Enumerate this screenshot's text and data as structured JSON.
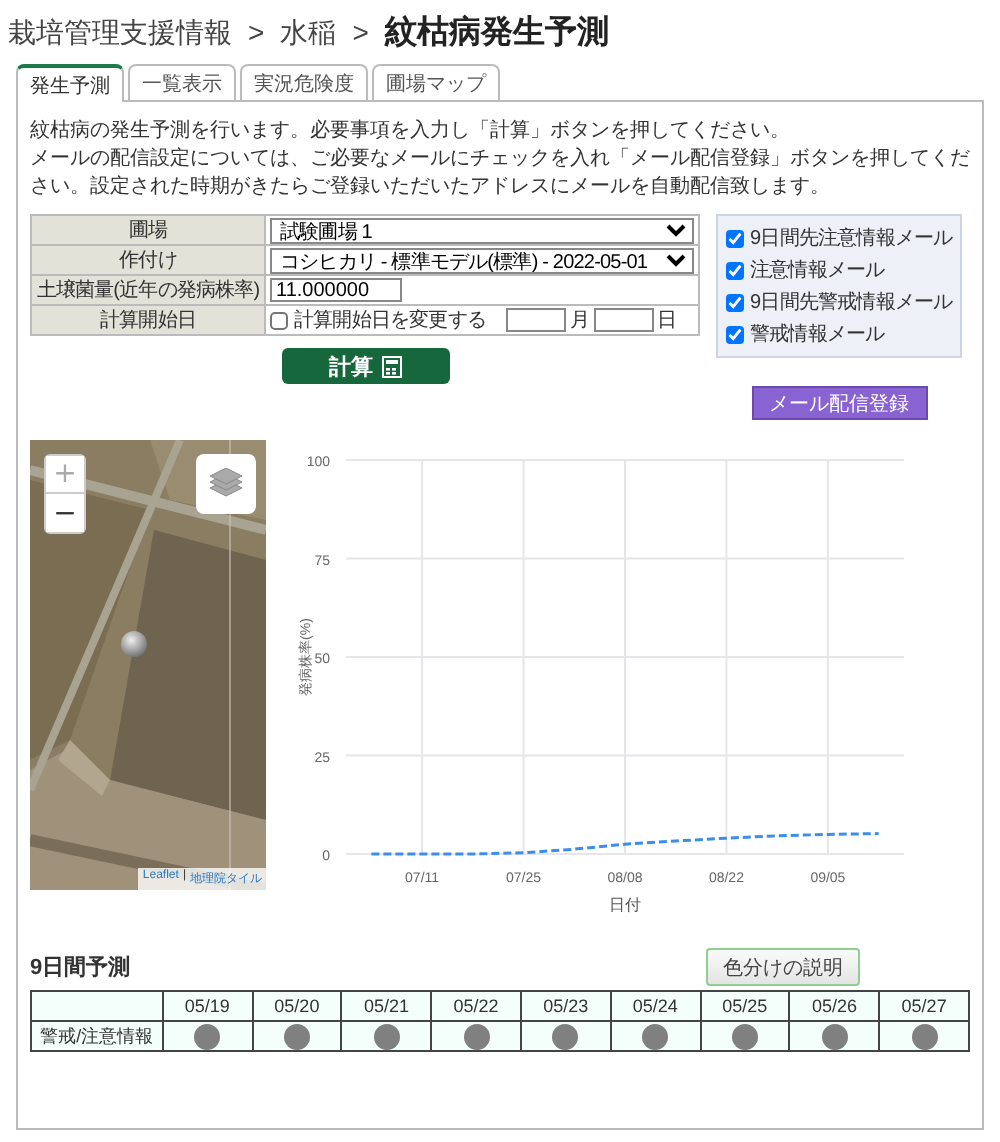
{
  "breadcrumb": [
    {
      "text": "栽培管理支援情報",
      "current": false
    },
    {
      "text": "水稲",
      "current": false
    },
    {
      "text": "紋枯病発生予測",
      "current": true
    }
  ],
  "breadcrumb_separator": ">",
  "tabs": [
    {
      "label": "発生予測",
      "selected": true
    },
    {
      "label": "一覧表示",
      "selected": false
    },
    {
      "label": "実況危険度",
      "selected": false
    },
    {
      "label": "圃場マップ",
      "selected": false
    }
  ],
  "description": [
    "紋枯病の発生予測を行います。必要事項を入力し「計算」ボタンを押してください。",
    "メールの配信設定については、ご必要なメールにチェックを入れ「メール配信登録」ボタンを押してください。設定された時期がきたらご登録いただいたアドレスにメールを自動配信致します。"
  ],
  "form": [
    {
      "kind": "select",
      "label": "圃場",
      "value": "試験圃場 1"
    },
    {
      "kind": "select",
      "label": "作付け",
      "value": "コシヒカリ - 標準モデル(標準) - 2022-05-01"
    },
    {
      "kind": "input",
      "label": "土壌菌量(近年の発病株率)",
      "value": "11.000000"
    },
    {
      "kind": "date",
      "label": "計算開始日",
      "checkbox_label": "計算開始日を変更する",
      "checked": false,
      "month_unit": "月",
      "day_unit": "日"
    }
  ],
  "mail_options": [
    {
      "label": "9日間先注意情報メール",
      "checked": true
    },
    {
      "label": "注意情報メール",
      "checked": true
    },
    {
      "label": "9日間先警戒情報メール",
      "checked": true
    },
    {
      "label": "警戒情報メール",
      "checked": true
    }
  ],
  "calculate_button": "計算",
  "mail_button": "メール配信登録",
  "map": {
    "zoom_in": "+",
    "zoom_out": "−",
    "attribution_link": "Leaflet",
    "attribution_separator": "|",
    "attribution_source": "地理院タイル"
  },
  "chart": {
    "chart_data": {
      "type": "line",
      "xlabel": "日付",
      "ylabel": "発病株率(%)",
      "categories": [
        null,
        "07/11",
        null,
        "07/25",
        null,
        "08/08",
        null,
        "08/22",
        null,
        "09/05",
        null
      ],
      "grid": true,
      "series": [
        {
          "color": "#3d8ee8",
          "line_style": "dashed",
          "values": [
            0,
            0,
            0,
            0.3,
            1.2,
            2.5,
            3.3,
            4.0,
            4.6,
            5.0,
            5.2
          ]
        }
      ],
      "ylim": [
        0,
        100
      ],
      "yticks": [
        0,
        25,
        50,
        75,
        100
      ]
    }
  },
  "forecast": {
    "title": "9日間予測",
    "legend_button": "色分けの説明",
    "row_label": "警戒/注意情報",
    "days": [
      {
        "date": "05/19",
        "color": "#808080"
      },
      {
        "date": "05/20",
        "color": "#808080"
      },
      {
        "date": "05/21",
        "color": "#808080"
      },
      {
        "date": "05/22",
        "color": "#808080"
      },
      {
        "date": "05/23",
        "color": "#808080"
      },
      {
        "date": "05/24",
        "color": "#808080"
      },
      {
        "date": "05/25",
        "color": "#808080"
      },
      {
        "date": "05/26",
        "color": "#808080"
      },
      {
        "date": "05/27",
        "color": "#808080"
      }
    ]
  }
}
